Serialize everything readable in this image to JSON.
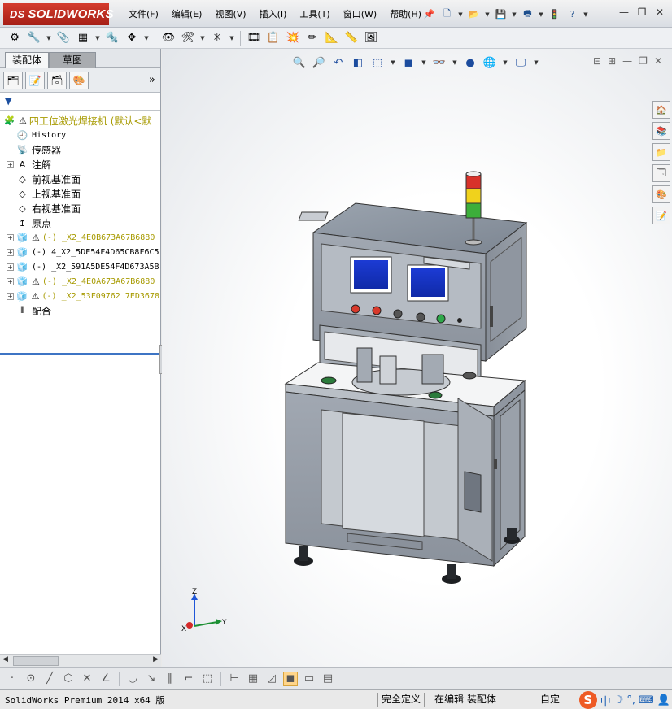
{
  "app": {
    "logo": "SOLIDWORKS",
    "logo_prefix": "DS",
    "menu": [
      "文件(F)",
      "编辑(E)",
      "视图(V)",
      "插入(I)",
      "工具(T)",
      "窗口(W)",
      "帮助(H)"
    ]
  },
  "panel": {
    "tabs": [
      "装配体",
      "草图"
    ],
    "tree": [
      {
        "label": "四工位激光焊接机  (默认<默",
        "icon": "assembly-icon",
        "warn": true,
        "color": "yellow",
        "mono": false,
        "expandable": false
      },
      {
        "label": "History",
        "icon": "history-icon",
        "warn": false,
        "color": "black",
        "mono": true,
        "expandable": false
      },
      {
        "label": "传感器",
        "icon": "sensor-icon",
        "warn": false,
        "color": "black",
        "mono": false,
        "expandable": false
      },
      {
        "label": "注解",
        "icon": "annotation-icon",
        "warn": false,
        "color": "black",
        "mono": false,
        "expandable": true
      },
      {
        "label": "前视基准面",
        "icon": "plane-icon",
        "warn": false,
        "color": "black",
        "mono": false,
        "expandable": false
      },
      {
        "label": "上视基准面",
        "icon": "plane-icon",
        "warn": false,
        "color": "black",
        "mono": false,
        "expandable": false
      },
      {
        "label": "右视基准面",
        "icon": "plane-icon",
        "warn": false,
        "color": "black",
        "mono": false,
        "expandable": false
      },
      {
        "label": "原点",
        "icon": "origin-icon",
        "warn": false,
        "color": "black",
        "mono": false,
        "expandable": false
      },
      {
        "label": "(-) _X2_4E0B673A67B6880",
        "icon": "part-icon",
        "warn": true,
        "color": "yellow",
        "mono": true,
        "expandable": true
      },
      {
        "label": "(-) 4_X2_5DE54F4D65CB8F6C5",
        "icon": "part-icon",
        "warn": false,
        "color": "black",
        "mono": true,
        "expandable": true
      },
      {
        "label": "(-) _X2_591A5DE54F4D673A5B",
        "icon": "part-icon",
        "warn": false,
        "color": "black",
        "mono": true,
        "expandable": true
      },
      {
        "label": "(-) _X2_4E0A673A67B6880",
        "icon": "part-icon",
        "warn": true,
        "color": "yellow",
        "mono": true,
        "expandable": true
      },
      {
        "label": "(-) _X2_53F09762 7ED3678",
        "icon": "part-icon",
        "warn": true,
        "color": "yellow",
        "mono": true,
        "expandable": true
      },
      {
        "label": "配合",
        "icon": "mates-icon",
        "warn": false,
        "color": "black",
        "mono": false,
        "expandable": false
      }
    ]
  },
  "triad": {
    "z": "Z",
    "x": "X",
    "y": "Y"
  },
  "status": {
    "product": "SolidWorks Premium 2014 x64 版",
    "defined": "完全定义",
    "editing": "在编辑 装配体",
    "custom": "自定"
  },
  "ime": {
    "brand": "S",
    "lang": "中"
  }
}
